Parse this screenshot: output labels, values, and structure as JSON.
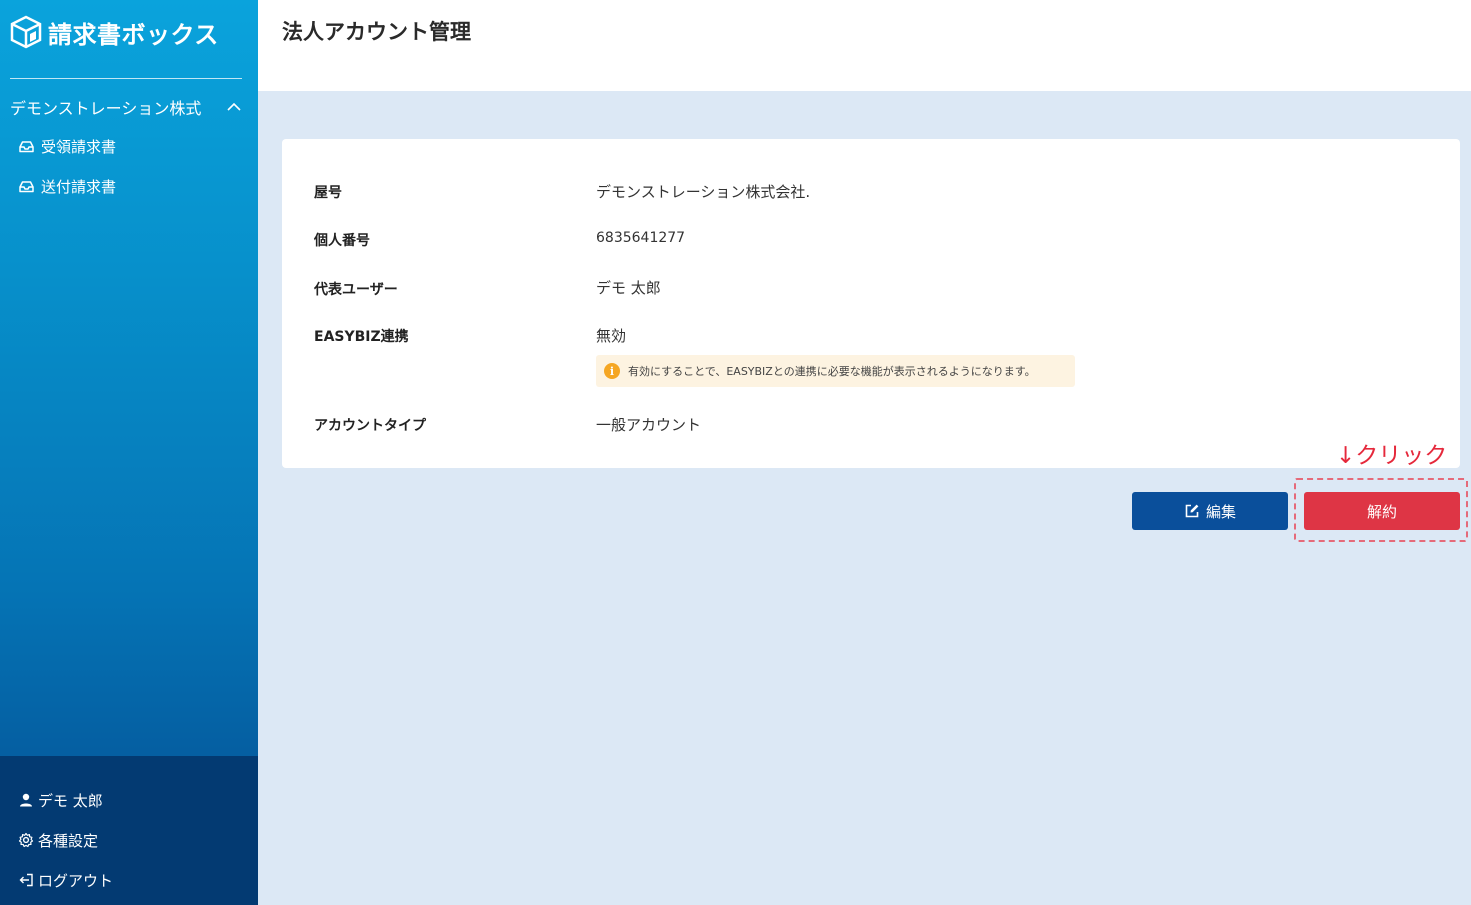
{
  "app": {
    "brand_name": "請求書ボックス",
    "page_title": "法人アカウント管理"
  },
  "sidebar": {
    "company_name": "デモンストレーション株式",
    "items": [
      {
        "label": "受領請求書",
        "icon": "inbox-icon"
      },
      {
        "label": "送付請求書",
        "icon": "inbox-icon"
      }
    ],
    "bottom": {
      "user_name": "デモ 太郎",
      "settings_label": "各種設定",
      "logout_label": "ログアウト"
    }
  },
  "account": {
    "fields": [
      {
        "label": "屋号",
        "value": "デモンストレーション株式会社."
      },
      {
        "label": "個人番号",
        "value": "6835641277"
      },
      {
        "label": "代表ユーザー",
        "value": "デモ 太郎"
      },
      {
        "label": "EASYBIZ連携",
        "value": "無効"
      },
      {
        "label": "アカウントタイプ",
        "value": "一般アカウント"
      }
    ],
    "notice": "有効にすることで、EASYBIZとの連携に必要な機能が表示されるようになります。",
    "notice_icon_glyph": "i"
  },
  "actions": {
    "edit_label": "編集",
    "cancel_label": "解約"
  },
  "annotation": {
    "text": "↓クリック"
  },
  "colors": {
    "sidebar_top": "#0aa3dc",
    "sidebar_bottom": "#033a72",
    "background": "#dce8f5",
    "edit_button": "#0a4f9b",
    "cancel_button": "#de3545",
    "notice_bg": "#fdf3e1",
    "notice_icon": "#f5a623",
    "annotation": "#e5283b"
  }
}
